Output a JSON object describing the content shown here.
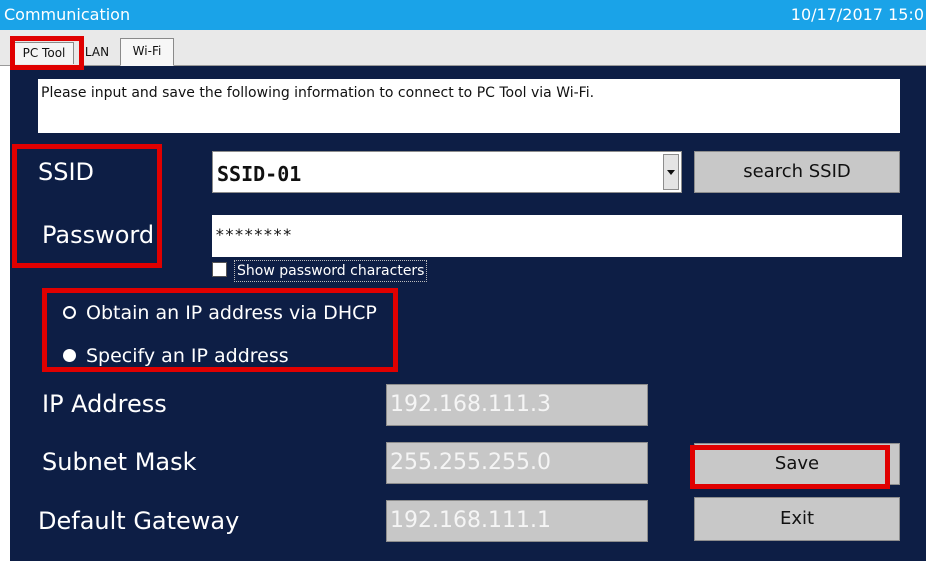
{
  "window": {
    "title": "Communication",
    "datetime": "10/17/2017 15:0"
  },
  "tabs": [
    {
      "label": "PC Tool"
    },
    {
      "label": "LAN"
    },
    {
      "label": "Wi-Fi"
    }
  ],
  "info": {
    "text": "Please input and save the following information to connect to PC Tool via Wi-Fi."
  },
  "ssid": {
    "label": "SSID",
    "value": "SSID-01",
    "search_label": "search SSID"
  },
  "password": {
    "label": "Password",
    "value": "********",
    "show_chars_label": "Show password characters"
  },
  "ip_mode": {
    "dhcp_label": "Obtain an IP address via DHCP",
    "specify_label": "Specify an IP address",
    "selected": "specify"
  },
  "network": {
    "ip_label": "IP Address",
    "ip_value": "192.168.111.3",
    "mask_label": "Subnet Mask",
    "mask_value": "255.255.255.0",
    "gateway_label": "Default Gateway",
    "gateway_value": "192.168.111.1"
  },
  "buttons": {
    "save": "Save",
    "exit": "Exit"
  },
  "colors": {
    "title_bar": "#1aa3e8",
    "panel": "#0d1e45",
    "highlight": "#e00000"
  }
}
